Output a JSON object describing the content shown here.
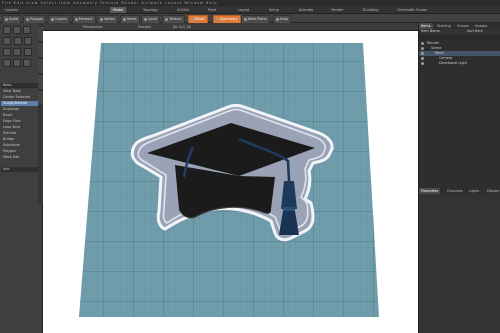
{
  "menubar": {
    "items": [
      "File",
      "Edit",
      "View",
      "Select",
      "Item",
      "Geometry",
      "Texture",
      "Render",
      "Animate",
      "Layout",
      "Window",
      "Help"
    ]
  },
  "tabbar": {
    "left_label": "Layouts",
    "tabs": [
      "Model",
      "Topology",
      "UV/UVs",
      "Paint",
      "Layout",
      "Setup",
      "Animate",
      "Render",
      "Sculpting",
      "Schematic Fusion"
    ],
    "active_index": 0
  },
  "toolbar": {
    "buttons": [
      "Scale",
      "Polygon",
      "Layers",
      "Element",
      "Vertex",
      "Items",
      "Local",
      "Texture",
      "Falloff",
      "Symmetry",
      "Work Plane",
      "Snap"
    ],
    "highlight_indices": [
      8,
      9
    ]
  },
  "left_panel": {
    "rows": [
      "Basic",
      "View Tools",
      "Center Selected",
      "Sculpt/Deform",
      "Duplicate",
      "Bevel",
      "Edge Slice",
      "Loop Slice",
      "Extrude",
      "Bridge",
      "Subdivide",
      "Polygon",
      "Mesh Edit"
    ],
    "highlight_index": 3,
    "bottom_label": "Info"
  },
  "viewport_header": {
    "left": "Perspective",
    "mid": "Shaded",
    "right": "No CLS_All"
  },
  "right_panel": {
    "tabs": [
      "Items",
      "Shading",
      "Groups",
      "Images"
    ],
    "active_tab": 0,
    "list_header": "Item Name",
    "list_header_right": "Sort Item",
    "items": [
      "Render",
      "Scene",
      "Mesh",
      "Camera",
      "Directional Light"
    ],
    "selected_index": 2,
    "props_tabs": [
      "Properties",
      "Channels",
      "Lights",
      "Display"
    ],
    "props_active": 0
  },
  "colors": {
    "accent": "#e07b39",
    "grid": "#6f9dab",
    "cap": "#1b1b1b",
    "tassel": "#1e3a5a"
  }
}
